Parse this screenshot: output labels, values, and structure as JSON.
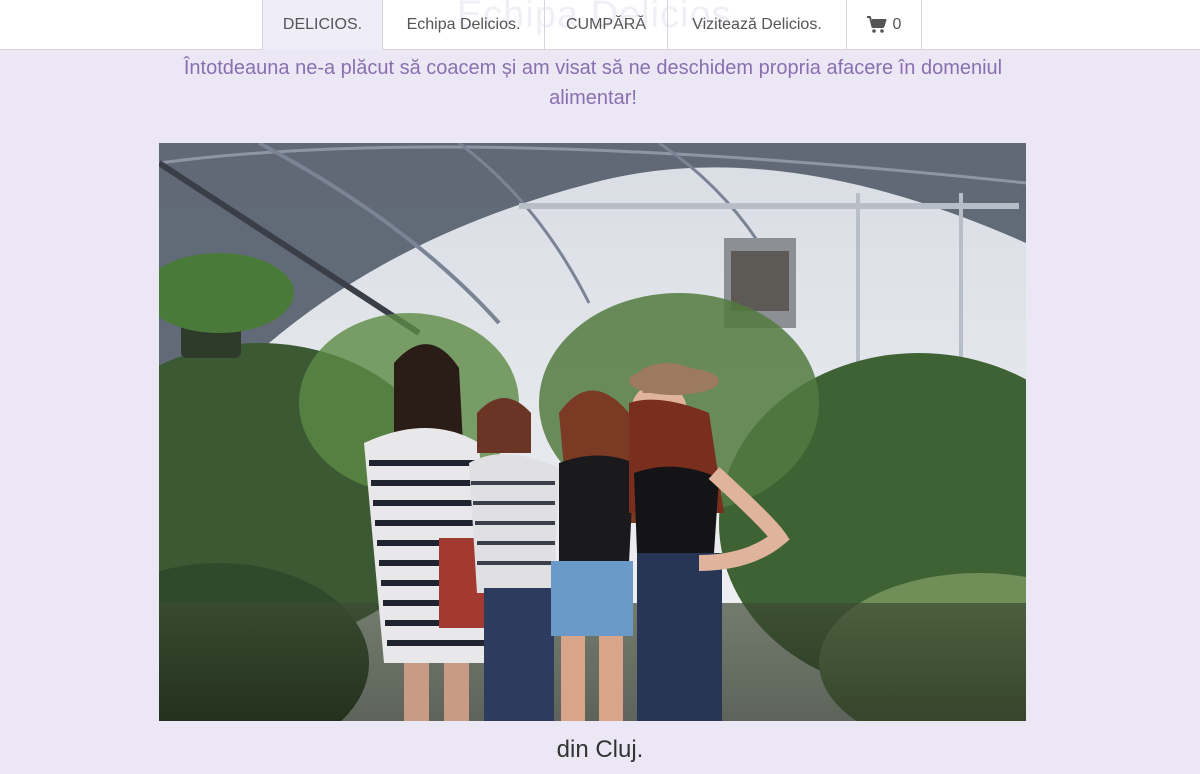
{
  "nav": {
    "ghost_title": "Echipa Delicios.",
    "items": [
      {
        "label": "DELICIOS."
      },
      {
        "label": "Echipa Delicios."
      },
      {
        "label": "CUMPĂRĂ"
      },
      {
        "label": "Vizitează Delicios."
      }
    ],
    "cart_count": "0",
    "cart_icon": "shopping-cart-icon"
  },
  "intro_text": "Întotdeauna ne-a plăcut să coacem și am visat să ne deschidem propria afacere în domeniul alimentar!",
  "photo": {
    "subject": "team-photo"
  },
  "caption": "din Cluj.",
  "colors": {
    "background": "#ebe7f5",
    "accent_text": "#8a6fb0",
    "nav_active": "#efedf7"
  }
}
